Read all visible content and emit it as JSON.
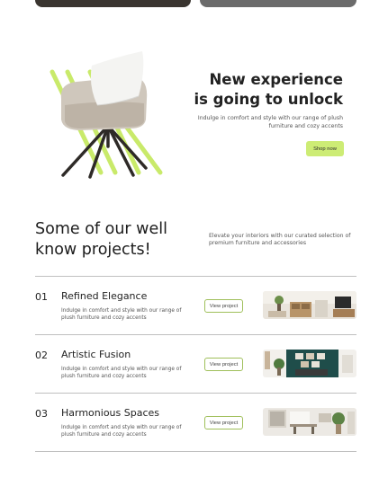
{
  "hero": {
    "title_line1": "New experience",
    "title_line2": "is going to unlock",
    "description": "Indulge in comfort and style with our range of plush furniture and cozy accents",
    "button_label": "Shop now"
  },
  "projects": {
    "title_line1": "Some of our well",
    "title_line2": "know projects!",
    "description": "Elevate your interiors with our curated selection of premium furniture and accessories",
    "items": [
      {
        "number": "01",
        "name": "Refined Elegance",
        "description": "Indulge in comfort and style with our range of plush furniture and cozy accents",
        "button_label": "View project"
      },
      {
        "number": "02",
        "name": "Artistic Fusion",
        "description": "Indulge in comfort and style with our range of plush furniture and cozy accents",
        "button_label": "View project"
      },
      {
        "number": "03",
        "name": "Harmonious Spaces",
        "description": "Indulge in comfort and style with our range of plush furniture and cozy accents",
        "button_label": "View project"
      }
    ]
  },
  "colors": {
    "accent": "#cdec75",
    "text": "#1f1f1f",
    "divider": "#bfbfbf"
  }
}
